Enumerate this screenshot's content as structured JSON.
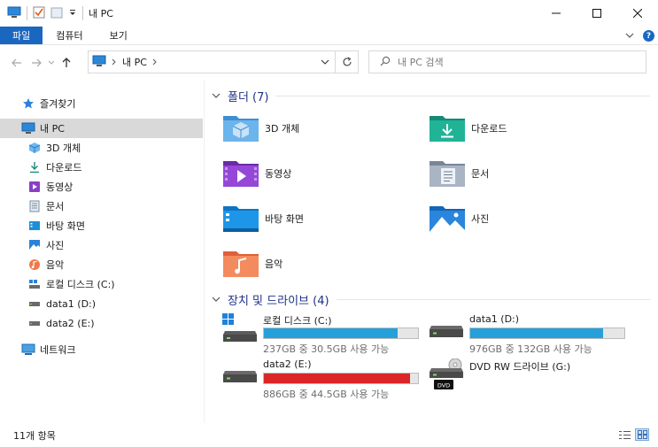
{
  "window": {
    "title": "내 PC"
  },
  "ribbon": {
    "tabs": [
      {
        "label": "파일"
      },
      {
        "label": "컴퓨터"
      },
      {
        "label": "보기"
      }
    ]
  },
  "address": {
    "crumb": "내 PC"
  },
  "search": {
    "placeholder": "내 PC 검색"
  },
  "sidebar": {
    "items": [
      {
        "label": "즐겨찾기",
        "icon": "star-icon"
      },
      {
        "label": "내 PC",
        "icon": "computer-icon",
        "selected": true
      },
      {
        "label": "3D 개체",
        "icon": "cube-icon"
      },
      {
        "label": "다운로드",
        "icon": "download-icon"
      },
      {
        "label": "동영상",
        "icon": "video-icon"
      },
      {
        "label": "문서",
        "icon": "document-icon"
      },
      {
        "label": "바탕 화면",
        "icon": "desktop-icon"
      },
      {
        "label": "사진",
        "icon": "pictures-icon"
      },
      {
        "label": "음악",
        "icon": "music-icon"
      },
      {
        "label": "로컬 디스크 (C:)",
        "icon": "drive-icon"
      },
      {
        "label": "data1 (D:)",
        "icon": "drive-icon"
      },
      {
        "label": "data2 (E:)",
        "icon": "drive-icon"
      },
      {
        "label": "네트워크",
        "icon": "network-icon"
      }
    ]
  },
  "groups": {
    "folders_header": "폴더 (7)",
    "drives_header": "장치 및 드라이브 (4)"
  },
  "folders": [
    {
      "label": "3D 개체",
      "icon": "3d-objects-folder-icon"
    },
    {
      "label": "다운로드",
      "icon": "downloads-folder-icon"
    },
    {
      "label": "동영상",
      "icon": "videos-folder-icon"
    },
    {
      "label": "문서",
      "icon": "documents-folder-icon"
    },
    {
      "label": "바탕 화면",
      "icon": "desktop-folder-icon"
    },
    {
      "label": "사진",
      "icon": "pictures-folder-icon"
    },
    {
      "label": "음악",
      "icon": "music-folder-icon"
    }
  ],
  "drives": [
    {
      "label": "로컬 디스크 (C:)",
      "space": "237GB 중 30.5GB 사용 가능",
      "used_fraction": 0.87,
      "color": "#26a0da"
    },
    {
      "label": "data1 (D:)",
      "space": "976GB 중 132GB 사용 가능",
      "used_fraction": 0.86,
      "color": "#26a0da"
    },
    {
      "label": "data2 (E:)",
      "space": "886GB 중 44.5GB 사용 가능",
      "used_fraction": 0.95,
      "color": "#da2626"
    },
    {
      "label": "DVD RW 드라이브 (G:)",
      "badge": "DVD"
    }
  ],
  "status": {
    "count": "11개 항목"
  },
  "colors": {
    "accent": "#1a67c0",
    "group_header": "#1e3287",
    "bar_normal": "#26a0da",
    "bar_full": "#da2626"
  }
}
